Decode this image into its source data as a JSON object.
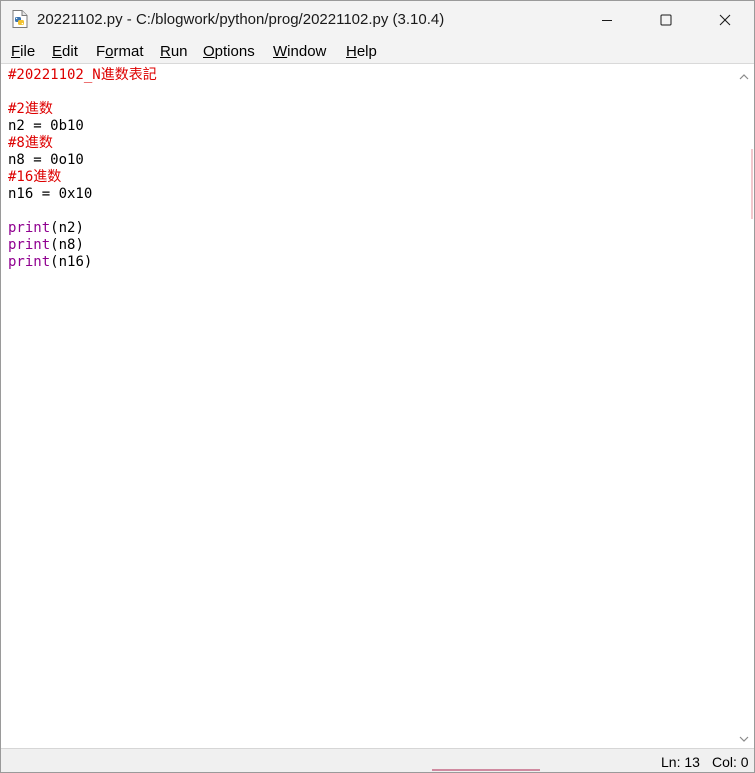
{
  "window": {
    "title": "20221102.py - C:/blogwork/python/prog/20221102.py (3.10.4)",
    "app_icon": "python-file-icon"
  },
  "menu": [
    {
      "label": "File",
      "accel": "F",
      "rest": "ile"
    },
    {
      "label": "Edit",
      "accel": "E",
      "rest": "dit"
    },
    {
      "label": "Format",
      "pre": "F",
      "accel": "o",
      "rest": "rmat"
    },
    {
      "label": "Run",
      "accel": "R",
      "rest": "un"
    },
    {
      "label": "Options",
      "accel": "O",
      "rest": "ptions"
    },
    {
      "label": "Window",
      "accel": "W",
      "rest": "indow"
    },
    {
      "label": "Help",
      "accel": "H",
      "rest": "elp"
    }
  ],
  "code_lines": [
    [
      {
        "t": "#20221102_N進数表記",
        "c": "comment"
      }
    ],
    [],
    [
      {
        "t": "#2進数",
        "c": "comment"
      }
    ],
    [
      {
        "t": "n2 = 0b10",
        "c": "plain"
      }
    ],
    [
      {
        "t": "#8進数",
        "c": "comment"
      }
    ],
    [
      {
        "t": "n8 = 0o10",
        "c": "plain"
      }
    ],
    [
      {
        "t": "#16進数",
        "c": "comment"
      }
    ],
    [
      {
        "t": "n16 = 0x10",
        "c": "plain"
      }
    ],
    [],
    [
      {
        "t": "print",
        "c": "builtin"
      },
      {
        "t": "(n2)",
        "c": "plain"
      }
    ],
    [
      {
        "t": "print",
        "c": "builtin"
      },
      {
        "t": "(n8)",
        "c": "plain"
      }
    ],
    [
      {
        "t": "print",
        "c": "builtin"
      },
      {
        "t": "(n16)",
        "c": "plain"
      }
    ]
  ],
  "status": {
    "line": "Ln: 13",
    "col": "Col: 0"
  },
  "colors": {
    "comment": "#dd0000",
    "builtin": "#900090",
    "plain": "#000000"
  }
}
